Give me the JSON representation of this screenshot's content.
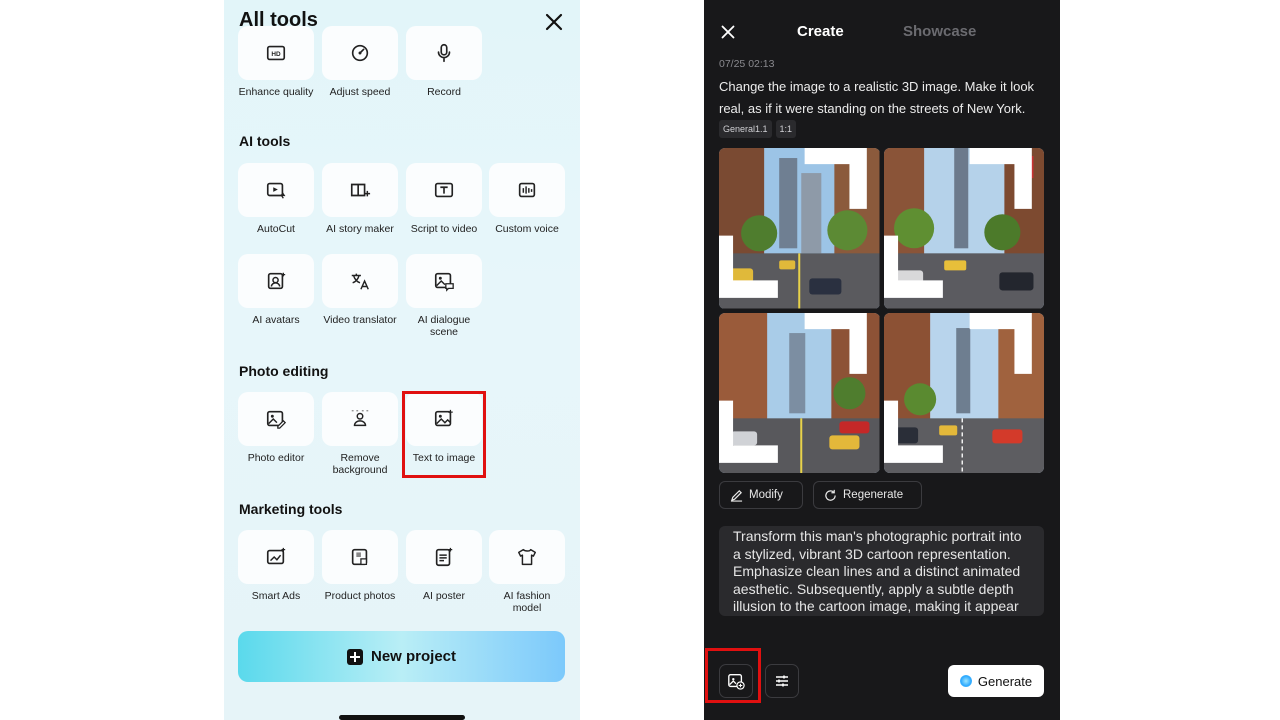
{
  "left": {
    "title": "All tools",
    "top_row": [
      {
        "label": "Enhance quality",
        "icon": "hd-icon"
      },
      {
        "label": "Adjust speed",
        "icon": "speed-icon"
      },
      {
        "label": "Record",
        "icon": "mic-icon"
      }
    ],
    "sections": {
      "ai_tools": {
        "title": "AI tools",
        "items": [
          {
            "label": "AutoCut",
            "icon": "autocut-icon"
          },
          {
            "label": "AI story maker",
            "icon": "story-icon"
          },
          {
            "label": "Script to video",
            "icon": "script-icon"
          },
          {
            "label": "Custom voice",
            "icon": "voice-icon"
          },
          {
            "label": "AI avatars",
            "icon": "avatar-icon"
          },
          {
            "label": "Video translator",
            "icon": "translate-icon"
          },
          {
            "label": "AI dialogue scene",
            "icon": "dialogue-icon"
          }
        ]
      },
      "photo_editing": {
        "title": "Photo editing",
        "items": [
          {
            "label": "Photo editor",
            "icon": "photo-edit-icon"
          },
          {
            "label": "Remove background",
            "icon": "remove-bg-icon"
          },
          {
            "label": "Text to image",
            "icon": "text-to-image-icon"
          }
        ]
      },
      "marketing_tools": {
        "title": "Marketing tools",
        "items": [
          {
            "label": "Smart Ads",
            "icon": "ads-icon"
          },
          {
            "label": "Product photos",
            "icon": "product-icon"
          },
          {
            "label": "AI poster",
            "icon": "poster-icon"
          },
          {
            "label": "AI fashion model",
            "icon": "fashion-icon"
          }
        ]
      }
    },
    "new_project": "New project"
  },
  "right": {
    "tabs": {
      "create": "Create",
      "showcase": "Showcase"
    },
    "date": "07/25 02:13",
    "prompt": "Change the image to a realistic 3D image. Make it look real, as if it were standing on the streets of New York.",
    "tags": [
      "General1.1",
      "1:1"
    ],
    "modify": "Modify",
    "regenerate": "Regenerate",
    "input_text": "Transform this man's photographic portrait into a stylized, vibrant 3D cartoon representation. Emphasize clean lines and a distinct animated aesthetic. Subsequently, apply a subtle depth illusion to the cartoon image, making it appear more lifelike for social",
    "generate": "Generate"
  },
  "colors": {
    "highlight": "#e01010",
    "dark_bg": "#18181a",
    "light_bg": "#e4f5f9"
  }
}
